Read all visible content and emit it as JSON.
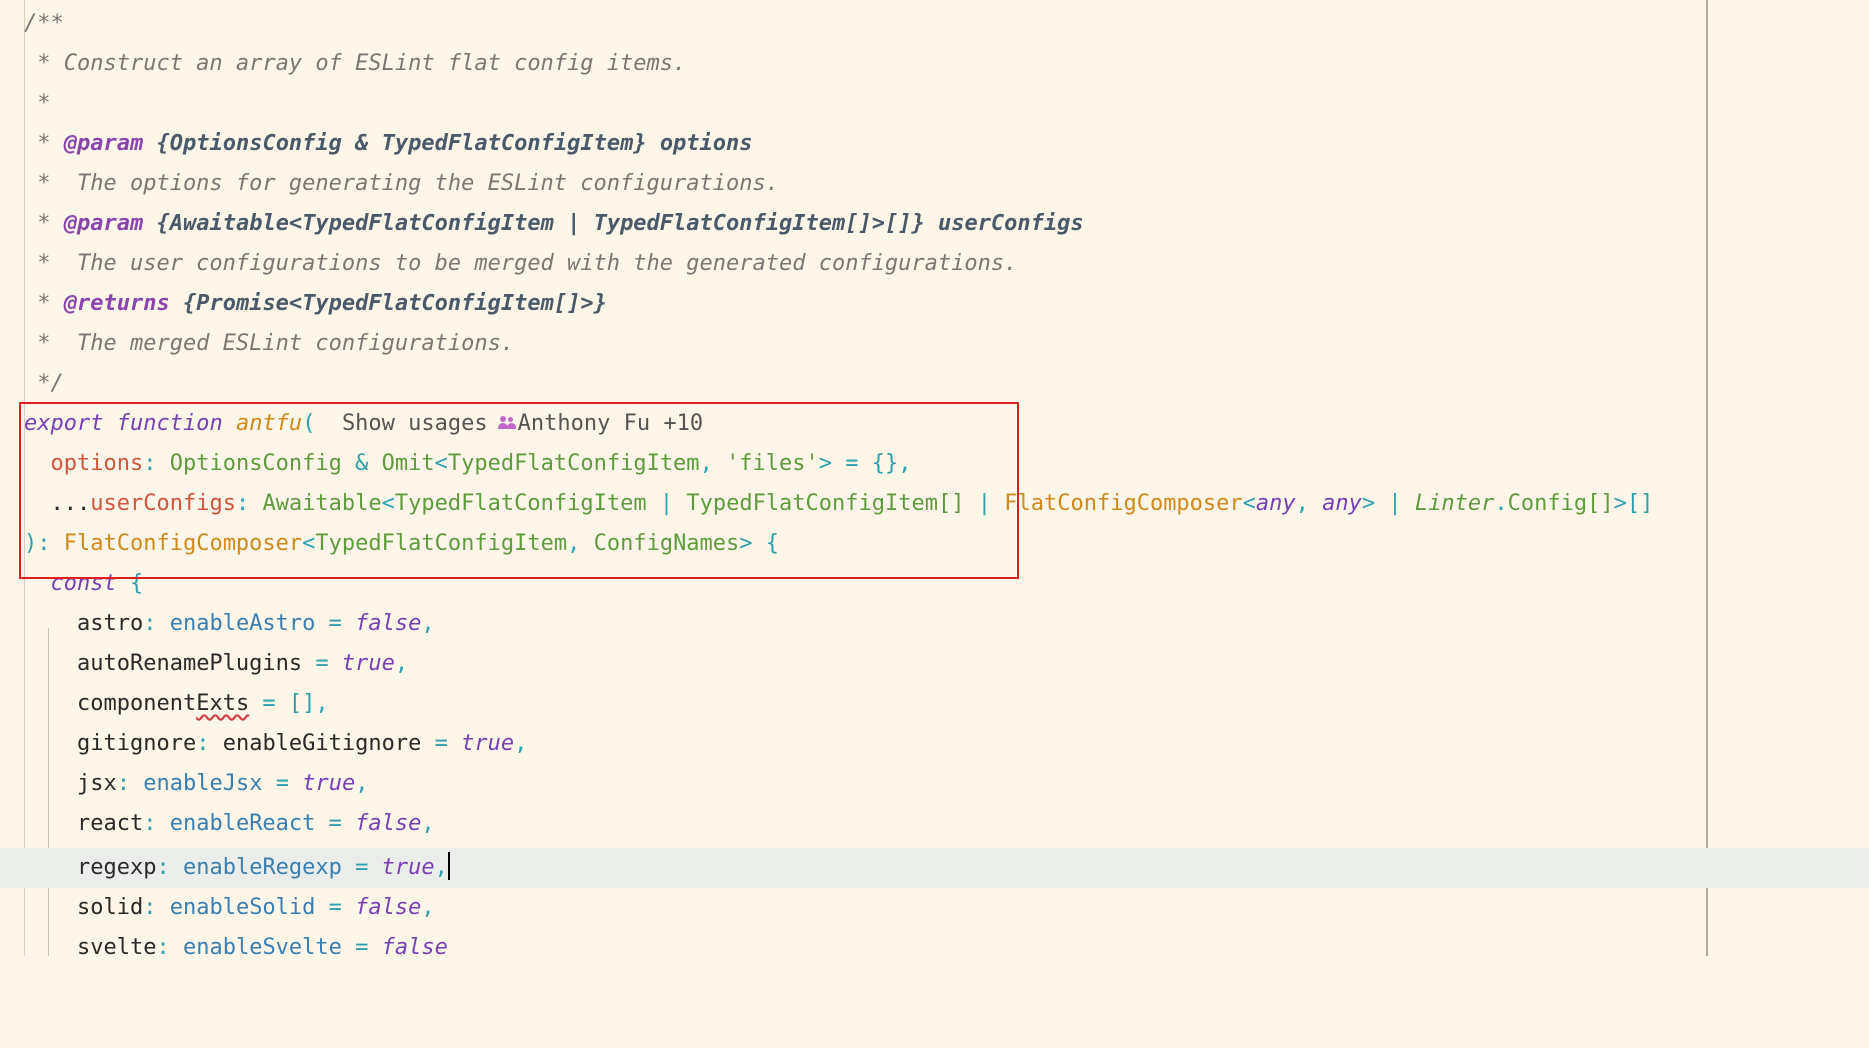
{
  "code": {
    "doc_open": "/**",
    "doc_summary": " * Construct an array of ESLint flat config items.",
    "doc_blank": " *",
    "doc_star": " * ",
    "param_tag": "@param",
    "param1_type": "{OptionsConfig & TypedFlatConfigItem}",
    "param1_name": "options",
    "param1_desc": " *  The options for generating the ESLint configurations.",
    "param2_type": "{Awaitable<TypedFlatConfigItem | TypedFlatConfigItem[]>[]}",
    "param2_name": "userConfigs",
    "param2_desc": " *  The user configurations to be merged with the generated configurations.",
    "returns_tag": "@returns",
    "returns_type": "{Promise<TypedFlatConfigItem[]>}",
    "returns_desc": " *  The merged ESLint configurations.",
    "doc_close": " */",
    "kw_export": "export",
    "kw_function": "function",
    "fn_name": "antfu",
    "open_paren": "(",
    "hint_usages": "Show usages",
    "hint_authors": "Anthony Fu +10",
    "options_param": "options",
    "options_type_a": "OptionsConfig",
    "options_type_b": "Omit",
    "options_type_c": "TypedFlatConfigItem",
    "options_str": "'files'",
    "spread": "...",
    "user_param": "userConfigs",
    "await_type": "Awaitable",
    "typed_item": "TypedFlatConfigItem",
    "typed_item_arr": "TypedFlatConfigItem[]",
    "composer": "FlatConfigComposer",
    "any": "any",
    "linter": "Linter",
    "config_arr": "Config[]",
    "return_composer": "FlatConfigComposer",
    "return_item": "TypedFlatConfigItem",
    "config_names": "ConfigNames",
    "kw_const": "const",
    "astro": "astro",
    "enable_astro": "enableAstro",
    "auto_rename": "autoRenamePlugins",
    "component_exts_a": "component",
    "component_exts_b": "Exts",
    "gitignore": "gitignore",
    "enable_gitignore": "enableGitignore",
    "jsx": "jsx",
    "enable_jsx": "enableJsx",
    "react": "react",
    "enable_react": "enableReact",
    "regexp": "regexp",
    "enable_regexp": "enableRegexp",
    "solid": "solid",
    "enable_solid": "enableSolid",
    "svelte": "svelte",
    "enable_svelte": "enableSvelte",
    "lit_false": "false",
    "lit_true": "true"
  }
}
